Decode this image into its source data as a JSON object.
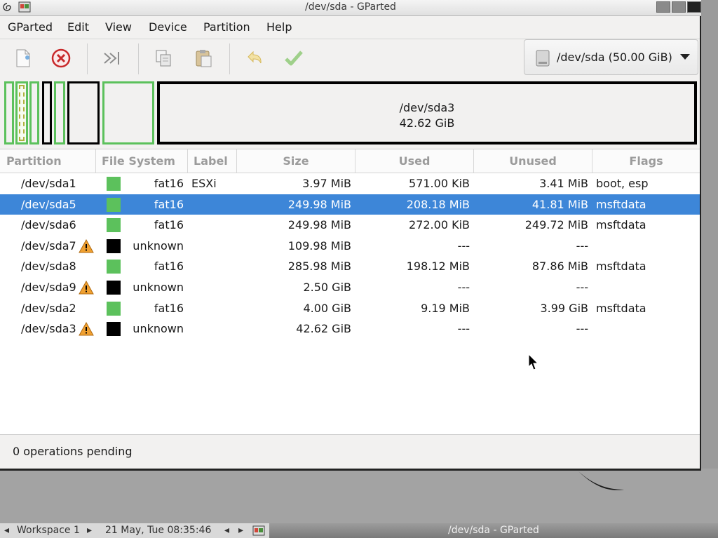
{
  "window": {
    "title": "/dev/sda - GParted"
  },
  "menubar": {
    "items": [
      "GParted",
      "Edit",
      "View",
      "Device",
      "Partition",
      "Help"
    ]
  },
  "toolbar": {
    "icons": [
      "new-partition-icon",
      "delete-icon",
      "resize-move-icon",
      "copy-icon",
      "paste-icon",
      "undo-icon",
      "apply-icon"
    ]
  },
  "device_selector": {
    "value": "/dev/sda (50.00 GiB)"
  },
  "disk_map": {
    "large_partition_name": "/dev/sda3",
    "large_partition_size": "42.62 GiB",
    "colors": {
      "fat16": "#5cc15c",
      "unknown": "#000000",
      "selected": "#3d86d8"
    }
  },
  "partition_table": {
    "headers": [
      "Partition",
      "File System",
      "Label",
      "Size",
      "Used",
      "Unused",
      "Flags"
    ],
    "rows": [
      {
        "partition": "/dev/sda1",
        "warn": false,
        "fs": "fat16",
        "fs_color": "#5cc15c",
        "label": "ESXi",
        "size": "3.97 MiB",
        "used": "571.00 KiB",
        "unused": "3.41 MiB",
        "flags": "boot, esp"
      },
      {
        "partition": "/dev/sda5",
        "warn": false,
        "fs": "fat16",
        "fs_color": "#5cc15c",
        "label": "",
        "size": "249.98 MiB",
        "used": "208.18 MiB",
        "unused": "41.81 MiB",
        "flags": "msftdata",
        "selected": true
      },
      {
        "partition": "/dev/sda6",
        "warn": false,
        "fs": "fat16",
        "fs_color": "#5cc15c",
        "label": "",
        "size": "249.98 MiB",
        "used": "272.00 KiB",
        "unused": "249.72 MiB",
        "flags": "msftdata"
      },
      {
        "partition": "/dev/sda7",
        "warn": true,
        "fs": "unknown",
        "fs_color": "#000000",
        "label": "",
        "size": "109.98 MiB",
        "used": "---",
        "unused": "---",
        "flags": ""
      },
      {
        "partition": "/dev/sda8",
        "warn": false,
        "fs": "fat16",
        "fs_color": "#5cc15c",
        "label": "",
        "size": "285.98 MiB",
        "used": "198.12 MiB",
        "unused": "87.86 MiB",
        "flags": "msftdata"
      },
      {
        "partition": "/dev/sda9",
        "warn": true,
        "fs": "unknown",
        "fs_color": "#000000",
        "label": "",
        "size": "2.50 GiB",
        "used": "---",
        "unused": "---",
        "flags": ""
      },
      {
        "partition": "/dev/sda2",
        "warn": false,
        "fs": "fat16",
        "fs_color": "#5cc15c",
        "label": "",
        "size": "4.00 GiB",
        "used": "9.19 MiB",
        "unused": "3.99 GiB",
        "flags": "msftdata"
      },
      {
        "partition": "/dev/sda3",
        "warn": true,
        "fs": "unknown",
        "fs_color": "#000000",
        "label": "",
        "size": "42.62 GiB",
        "used": "---",
        "unused": "---",
        "flags": ""
      }
    ]
  },
  "status": {
    "text": "0 operations pending"
  },
  "panel": {
    "workspace": "Workspace 1",
    "datetime": "21 May, Tue 08:35:46",
    "task": "/dev/sda - GParted"
  }
}
